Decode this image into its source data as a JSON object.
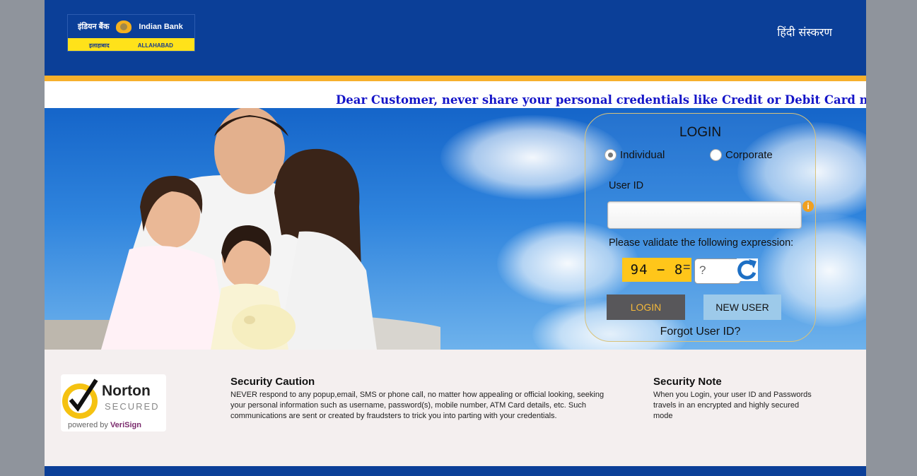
{
  "header": {
    "logo_hindi": "इंडियन बैंक",
    "logo_english": "Indian Bank",
    "logo_sub_hindi": "इलाहाबाद",
    "logo_sub_english": "ALLAHABAD",
    "language_link": "हिंदी संस्करण"
  },
  "marquee": {
    "text": "Dear Customer, never share your personal credentials like Credit or Debit Card num"
  },
  "login": {
    "title": "LOGIN",
    "radio_individual": "Individual",
    "radio_corporate": "Corporate",
    "selected_type": "Individual",
    "user_id_label": "User ID",
    "user_id_value": "",
    "info_glyph": "i",
    "captcha_prompt": "Please validate the following expression:",
    "captcha_expression": "94 − 8",
    "captcha_equals": "=",
    "captcha_placeholder": "?",
    "login_button": "LOGIN",
    "new_user_button": "NEW USER",
    "forgot_link": "Forgot User ID?"
  },
  "footer": {
    "norton_brand": "Norton",
    "norton_secured": "SECURED",
    "norton_powered": "powered by",
    "norton_verisign": "VeriSign",
    "caution_title": "Security Caution",
    "caution_text": "NEVER respond to any popup,email, SMS or phone call, no matter how appealing or official looking, seeking your personal information such as username, password(s), mobile number, ATM Card details, etc. Such communications are sent or created by fraudsters to trick you into parting with your credentials.",
    "note_title": "Security Note",
    "note_text": "When you Login, your user ID and Passwords travels in an encrypted and highly secured mode"
  },
  "colors": {
    "brand_blue": "#0b3f98",
    "gold": "#f6b02c",
    "marquee_text": "#1515c8",
    "captcha_bg": "#ffc61a"
  }
}
